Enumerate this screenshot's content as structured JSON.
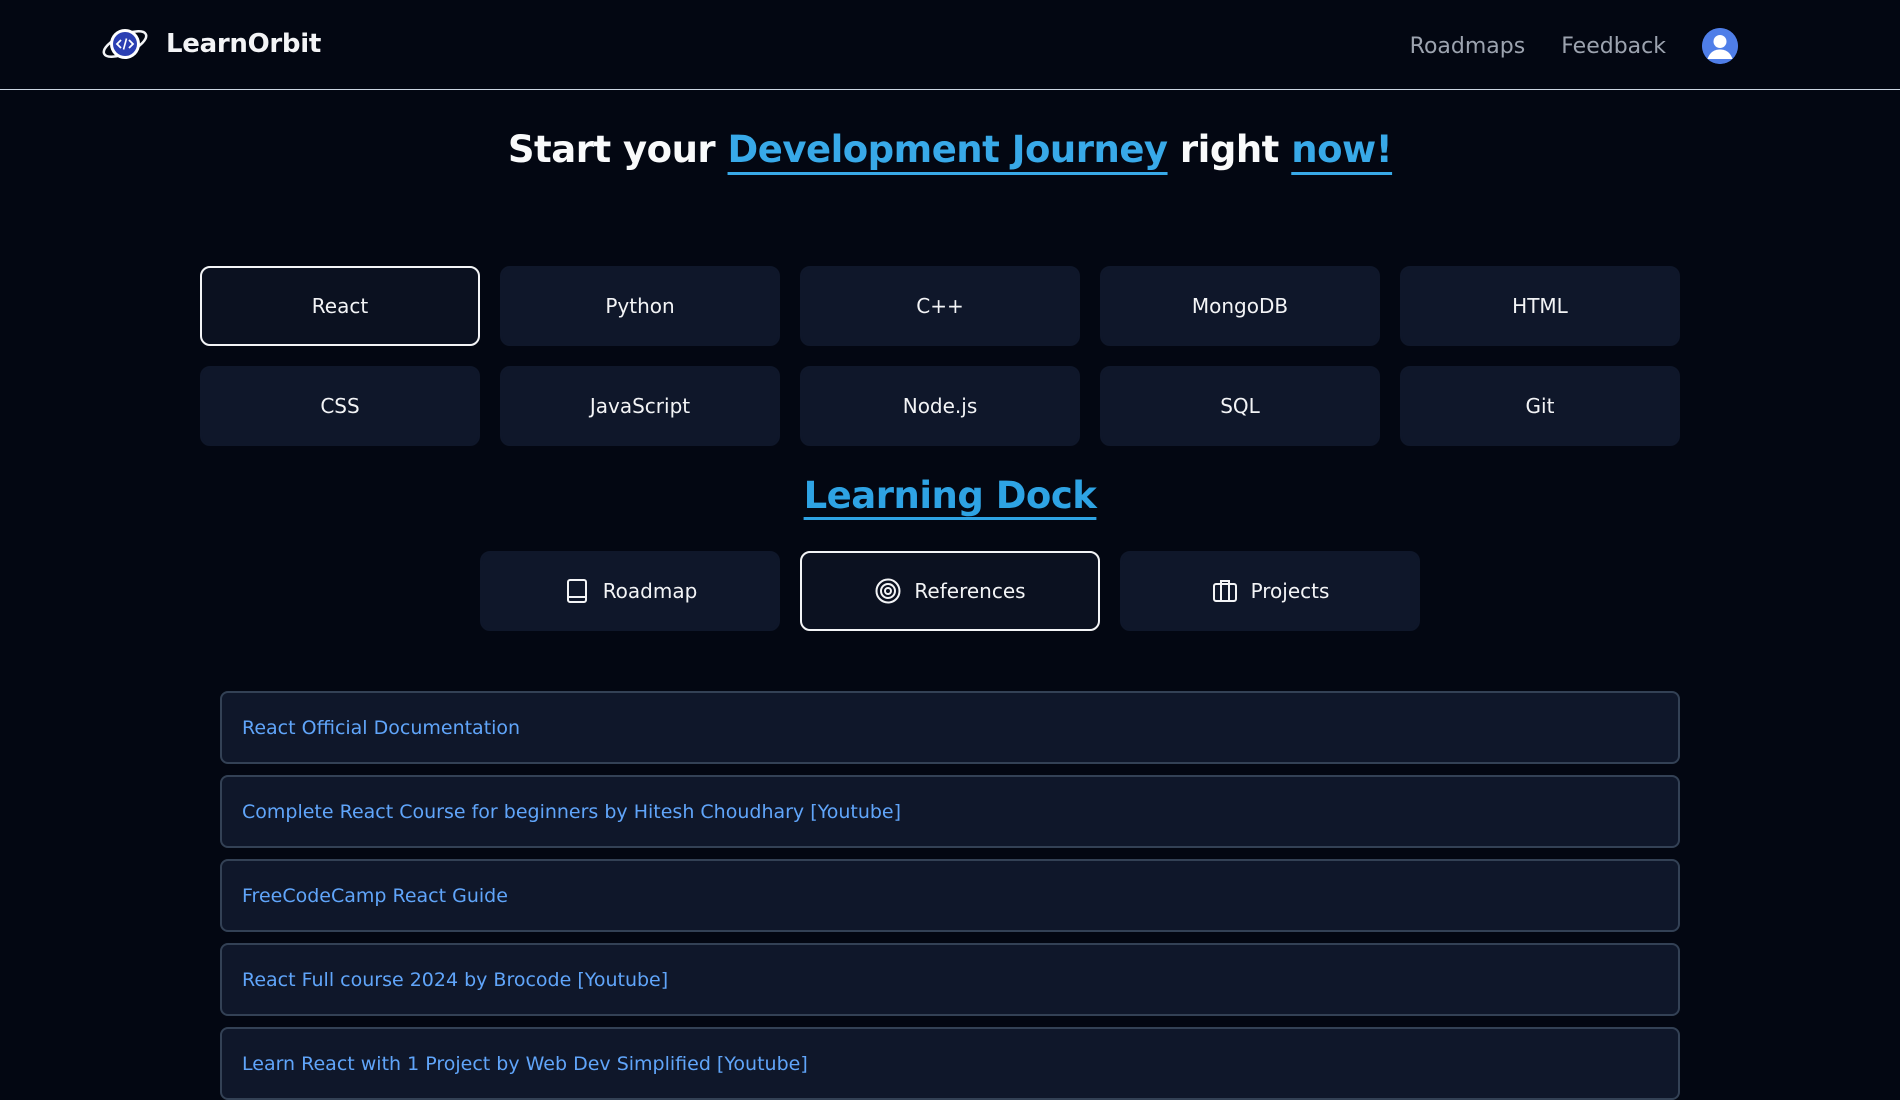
{
  "brand": {
    "name": "LearnOrbit",
    "logo_icon": "planet-code-icon"
  },
  "nav": {
    "links": [
      "Roadmaps",
      "Feedback"
    ],
    "avatar_icon": "user-avatar-icon"
  },
  "hero": {
    "part1": "Start your ",
    "highlight1": "Development Journey",
    "part2": " right ",
    "highlight2": "now!"
  },
  "technologies": {
    "items": [
      "React",
      "Python",
      "C++",
      "MongoDB",
      "HTML",
      "CSS",
      "JavaScript",
      "Node.js",
      "SQL",
      "Git"
    ],
    "selected": "React"
  },
  "dock": {
    "title": "Learning Dock",
    "tabs": [
      {
        "label": "Roadmap",
        "icon": "book-icon"
      },
      {
        "label": "References",
        "icon": "target-icon"
      },
      {
        "label": "Projects",
        "icon": "briefcase-icon"
      }
    ],
    "selected": "References"
  },
  "references": {
    "items": [
      "React Official Documentation",
      "Complete React Course for beginners by Hitesh Choudhary [Youtube]",
      "FreeCodeCamp React Guide",
      "React Full course 2024 by Brocode [Youtube]",
      "Learn React with 1 Project by Web Dev Simplified [Youtube]"
    ]
  },
  "colors": {
    "background": "#030712",
    "accent": "#38a9e8",
    "link": "#60a5fa",
    "card": "#0f172a"
  }
}
